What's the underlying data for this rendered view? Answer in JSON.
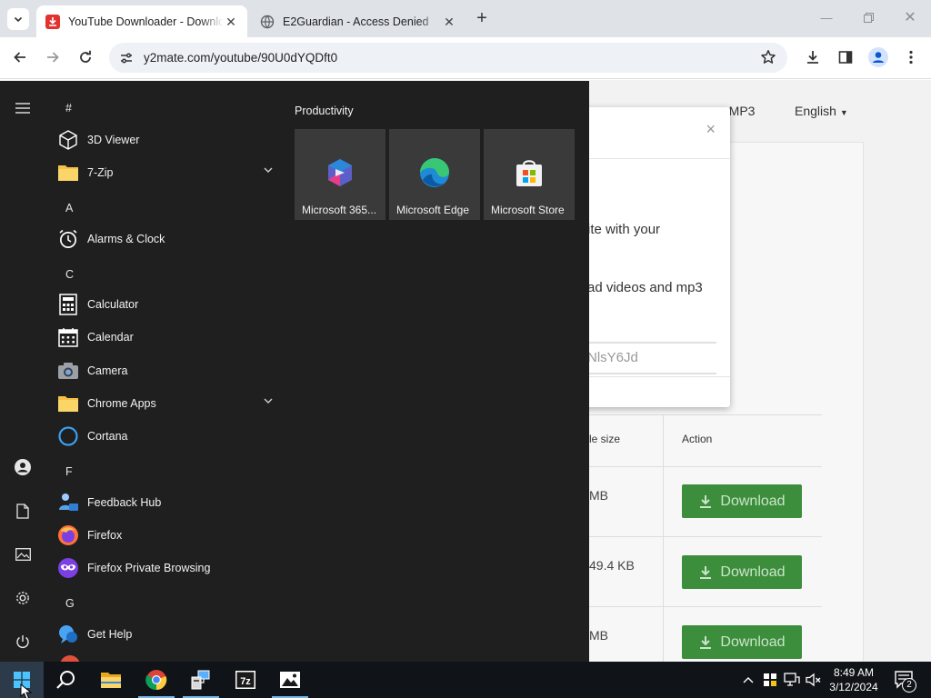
{
  "browser": {
    "tabs": [
      {
        "title": "YouTube Downloader - Downlo",
        "active": true
      },
      {
        "title": "E2Guardian - Access Denied",
        "active": false
      }
    ],
    "url": "y2mate.com/youtube/90U0dYQDft0"
  },
  "page": {
    "nav_mp3": "o MP3",
    "language": "English",
    "modal": {
      "close": "×",
      "text1": "ite with your",
      "text2": "ad videos and mp3",
      "input_value": "NlsY6Jd"
    },
    "table": {
      "col_size": "le size",
      "col_action": "Action",
      "rows": [
        {
          "size": "MB",
          "action": "Download"
        },
        {
          "size": "49.4 KB",
          "action": "Download"
        },
        {
          "size": "MB",
          "action": "Download"
        }
      ]
    }
  },
  "start_menu": {
    "sections": [
      {
        "letter": "#",
        "apps": [
          {
            "label": "3D Viewer",
            "icon": "cube-icon",
            "expandable": false
          },
          {
            "label": "7-Zip",
            "icon": "folder-icon",
            "expandable": true
          }
        ]
      },
      {
        "letter": "A",
        "apps": [
          {
            "label": "Alarms & Clock",
            "icon": "clock-icon",
            "expandable": false
          }
        ]
      },
      {
        "letter": "C",
        "apps": [
          {
            "label": "Calculator",
            "icon": "calculator-icon",
            "expandable": false
          },
          {
            "label": "Calendar",
            "icon": "calendar-icon",
            "expandable": false
          },
          {
            "label": "Camera",
            "icon": "camera-icon",
            "expandable": false
          },
          {
            "label": "Chrome Apps",
            "icon": "folder-icon",
            "expandable": true
          },
          {
            "label": "Cortana",
            "icon": "cortana-icon",
            "expandable": false
          }
        ]
      },
      {
        "letter": "F",
        "apps": [
          {
            "label": "Feedback Hub",
            "icon": "feedback-icon",
            "expandable": false
          },
          {
            "label": "Firefox",
            "icon": "firefox-icon",
            "expandable": false
          },
          {
            "label": "Firefox Private Browsing",
            "icon": "firefox-private-icon",
            "expandable": false
          }
        ]
      },
      {
        "letter": "G",
        "apps": [
          {
            "label": "Get Help",
            "icon": "help-icon",
            "expandable": false
          }
        ]
      }
    ],
    "tile_group": "Productivity",
    "tiles": [
      {
        "label": "Microsoft 365...",
        "icon": "microsoft-365-icon"
      },
      {
        "label": "Microsoft Edge",
        "icon": "edge-icon"
      },
      {
        "label": "Microsoft Store",
        "icon": "store-icon"
      }
    ]
  },
  "taskbar": {
    "time": "8:49 AM",
    "date": "3/12/2024",
    "notification_count": "2"
  },
  "colors": {
    "start_bg": "#1f1f1f",
    "tile_bg": "#3a3a3a",
    "taskbar_bg": "#101418",
    "download_green": "#3c8d3c"
  }
}
